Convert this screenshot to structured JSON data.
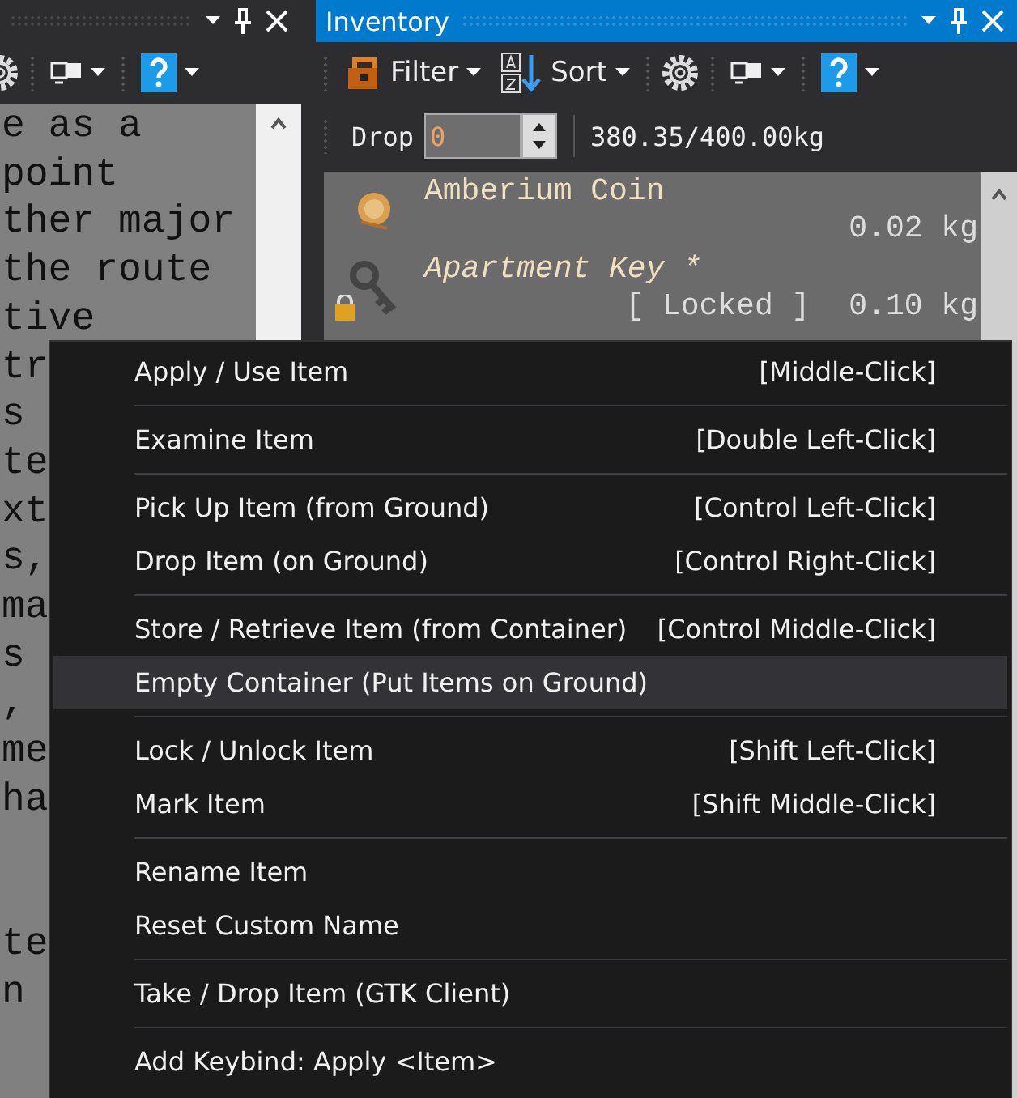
{
  "left_panel": {
    "paragraphs": [
      [
        "e as a",
        "point",
        "ther major",
        "the route",
        "tive",
        "tr",
        "s",
        "te",
        "xt",
        "s,",
        "ma",
        "s",
        ",",
        "me",
        "ha"
      ],
      [
        "te",
        "n"
      ]
    ]
  },
  "inventory": {
    "title": "Inventory",
    "toolbar": [
      {
        "kind": "filter",
        "label": "Filter"
      },
      {
        "kind": "sort",
        "label": "Sort"
      }
    ],
    "drop": {
      "label": "Drop",
      "value": "0"
    },
    "weight": "380.35/400.00kg",
    "items": [
      {
        "name": "Amberium Coin",
        "kind": "coin",
        "italic": false,
        "locked": false,
        "weight": "0.02 kg",
        "color": "#f0e0c0"
      },
      {
        "name": "Apartment Key *",
        "kind": "key",
        "italic": true,
        "locked": true,
        "status": "[ Locked ]",
        "weight": "0.10 kg",
        "color": "#f0e0c0"
      }
    ]
  },
  "context_menu": {
    "groups": [
      [
        {
          "label": "Apply / Use Item",
          "shortcut": "[Middle-Click]",
          "selected": false
        }
      ],
      [
        {
          "label": "Examine Item",
          "shortcut": "[Double Left-Click]",
          "selected": false
        }
      ],
      [
        {
          "label": "Pick Up Item (from Ground)",
          "shortcut": "[Control Left-Click]",
          "selected": false
        },
        {
          "label": "Drop Item (on Ground)",
          "shortcut": "[Control Right-Click]",
          "selected": false
        }
      ],
      [
        {
          "label": "Store / Retrieve Item (from Container)",
          "shortcut": "[Control Middle-Click]",
          "selected": false
        },
        {
          "label": "Empty Container (Put Items on Ground)",
          "selected": true
        }
      ],
      [
        {
          "label": "Lock / Unlock Item",
          "shortcut": "[Shift Left-Click]",
          "selected": false
        },
        {
          "label": "Mark Item",
          "shortcut": "[Shift Middle-Click]",
          "selected": false
        }
      ],
      [
        {
          "label": "Rename Item",
          "selected": false
        },
        {
          "label": "Reset Custom Name",
          "selected": false
        }
      ],
      [
        {
          "label": "Take / Drop Item (GTK Client)",
          "selected": false
        }
      ],
      [
        {
          "label": "Add Keybind: Apply <Item>",
          "selected": false
        }
      ]
    ]
  }
}
